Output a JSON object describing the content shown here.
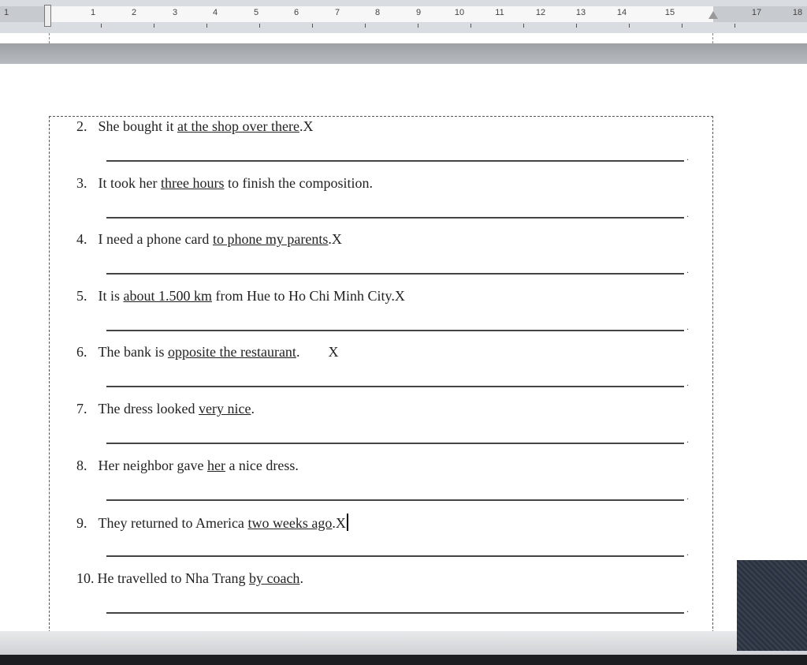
{
  "ruler": {
    "labels": [
      "1",
      "1",
      "2",
      "3",
      "4",
      "5",
      "6",
      "7",
      "8",
      "9",
      "10",
      "11",
      "12",
      "13",
      "14",
      "15",
      "17",
      "18"
    ]
  },
  "exercise": {
    "items": [
      {
        "num": "2.",
        "before": "She bought it ",
        "underlined": "at the shop over there",
        "after": ".",
        "mark": "X"
      },
      {
        "num": "3.",
        "before": "It took her ",
        "underlined": "three hours",
        "after": " to finish the composition.",
        "mark": ""
      },
      {
        "num": "4.",
        "before": "I need a phone card ",
        "underlined": "to phone my parents",
        "after": ".",
        "mark": "X"
      },
      {
        "num": "5.",
        "before": "It is ",
        "underlined": "about 1.500 km",
        "after": " from Hue to Ho Chi Minh City.",
        "mark": "X"
      },
      {
        "num": "6.",
        "before": "The bank is ",
        "underlined": "opposite the restaurant",
        "after": ".        ",
        "mark": "X"
      },
      {
        "num": "7.",
        "before": "The dress looked ",
        "underlined": "very nice",
        "after": ".",
        "mark": ""
      },
      {
        "num": "8.",
        "before": "Her neighbor gave ",
        "underlined": "her",
        "after": " a nice dress.",
        "mark": ""
      },
      {
        "num": "9.",
        "before": "They returned to America ",
        "underlined": "two weeks ago",
        "after": ".",
        "mark": "X"
      },
      {
        "num": "10.",
        "before": "He travelled to Nha Trang ",
        "underlined": "by coach",
        "after": ".",
        "mark": ""
      }
    ],
    "line_end": "."
  }
}
